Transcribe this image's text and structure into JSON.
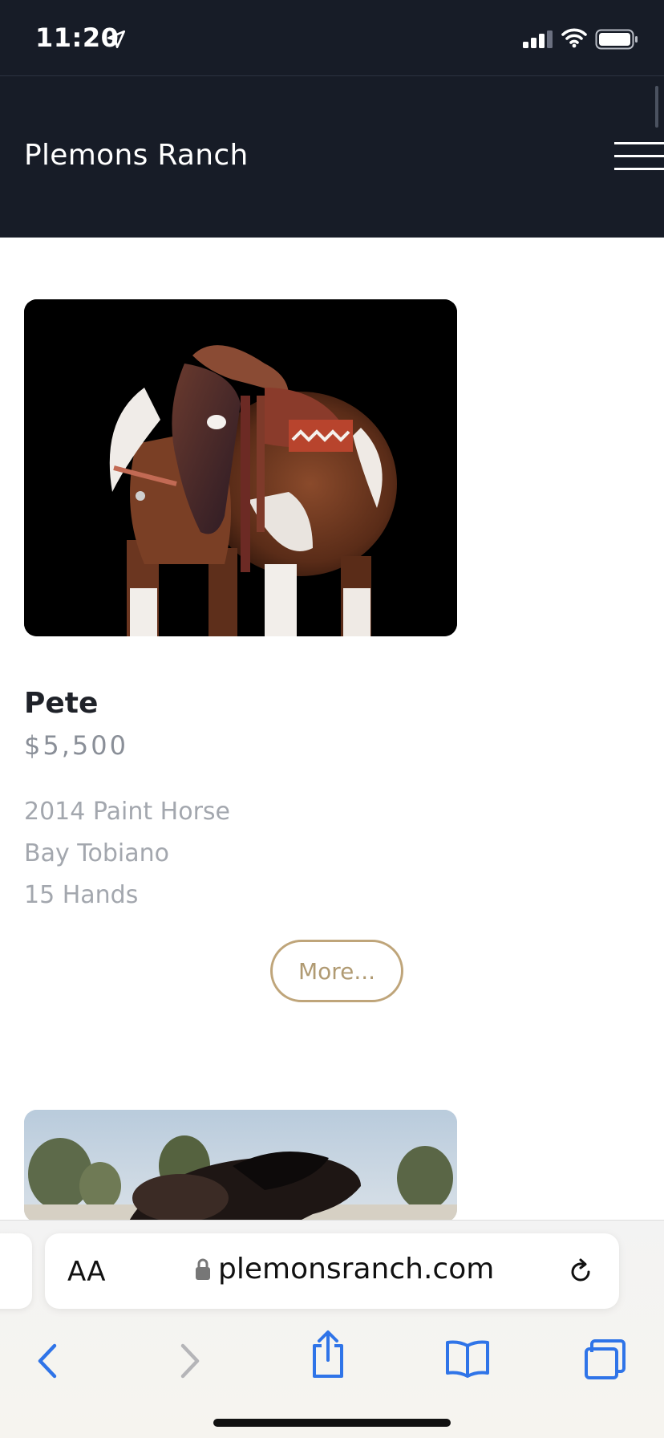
{
  "status_bar": {
    "time": "11:20",
    "icons": [
      "location-arrow-icon",
      "cellular-signal-icon",
      "wifi-icon",
      "battery-icon"
    ]
  },
  "header": {
    "site_title": "Plemons Ranch",
    "menu_icon": "hamburger-menu-icon"
  },
  "listings": [
    {
      "name": "Pete",
      "price": "$5,500",
      "details": [
        "2014 Paint Horse",
        "Bay Tobiano",
        "15 Hands"
      ],
      "more_label": "More..."
    }
  ],
  "safari": {
    "text_size_label": "AA",
    "url": "plemonsranch.com",
    "toolbar": [
      "back-icon",
      "forward-icon",
      "share-icon",
      "bookmarks-icon",
      "tabs-icon"
    ]
  },
  "colors": {
    "header_bg": "#171c27",
    "accent_gold": "#bfa57a",
    "safari_blue": "#2f74e8"
  }
}
